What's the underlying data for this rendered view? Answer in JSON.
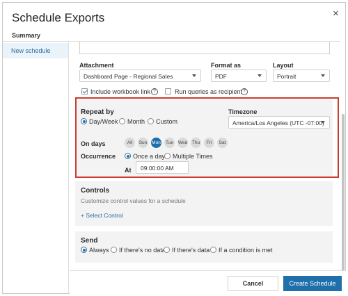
{
  "dialog": {
    "title": "Schedule Exports",
    "close_glyph": "×"
  },
  "sidebar": {
    "heading": "Summary",
    "items": [
      {
        "label": "New schedule",
        "active": true
      }
    ]
  },
  "attachment": {
    "label": "Attachment",
    "value": "Dashboard Page - Regional Sales",
    "format_label": "Format as",
    "format_value": "PDF",
    "layout_label": "Layout",
    "layout_value": "Portrait",
    "include_workbook_link": {
      "label": "Include workbook link",
      "checked": true
    },
    "run_as_recipient": {
      "label": "Run queries as recipient",
      "checked": false
    },
    "help_glyph": "?"
  },
  "repeat": {
    "label": "Repeat by",
    "options": [
      {
        "label": "Day/Week",
        "selected": true
      },
      {
        "label": "Month",
        "selected": false
      },
      {
        "label": "Custom",
        "selected": false
      }
    ],
    "timezone_label": "Timezone",
    "timezone_value": "America/Los Angeles (UTC -07:00)",
    "on_days_label": "On days",
    "days": [
      {
        "label": "All",
        "selected": false
      },
      {
        "label": "Sun",
        "selected": false
      },
      {
        "label": "Mon",
        "selected": true
      },
      {
        "label": "Tue",
        "selected": false
      },
      {
        "label": "Wed",
        "selected": false
      },
      {
        "label": "Thu",
        "selected": false
      },
      {
        "label": "Fri",
        "selected": false
      },
      {
        "label": "Sat",
        "selected": false
      }
    ],
    "occurrence_label": "Occurrence",
    "occurrence_options": [
      {
        "label": "Once a day",
        "selected": true
      },
      {
        "label": "Multiple Times",
        "selected": false
      }
    ],
    "at_label": "At",
    "at_value": "09:00:00 AM"
  },
  "controls": {
    "title": "Controls",
    "subtitle": "Customize control values for a schedule",
    "add_link": "+ Select Control"
  },
  "send": {
    "title": "Send",
    "options": [
      {
        "label": "Always",
        "selected": true
      },
      {
        "label": "If there's no data",
        "selected": false
      },
      {
        "label": "If there's data",
        "selected": false
      },
      {
        "label": "If a condition is met",
        "selected": false
      }
    ]
  },
  "footer": {
    "cancel_label": "Cancel",
    "create_label": "Create Schedule"
  },
  "colors": {
    "accent": "#1f6fab",
    "highlight_border": "#cc3b2f",
    "panel_bg": "#f3f3f3"
  }
}
